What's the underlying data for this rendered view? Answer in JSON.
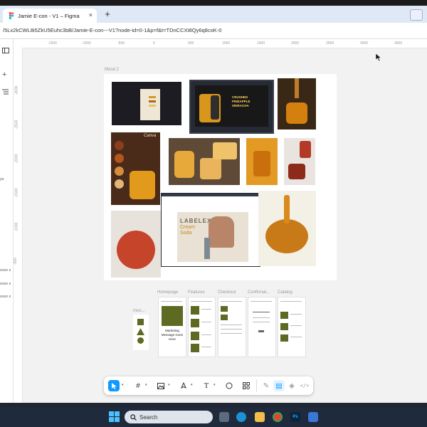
{
  "browser": {
    "tab_title": "Jamie E-con - V1 – Figma",
    "tab_close": "×",
    "new_tab": "+",
    "url": "/5Lx2kCWL8i5ZkU5Euhc3bB/Jamie-E-con---V1?node-id=0-1&p=f&t=TDnCCXt8Qy6q8coK-0"
  },
  "rulers": {
    "top_ticks": [
      "-1500",
      "-1000",
      "-500",
      "0",
      "500",
      "1000",
      "1500",
      "2000",
      "2500",
      "3000",
      "3500"
    ],
    "left_ticks": [
      "-3000",
      "-2500",
      "-2000",
      "-1500",
      "-1000",
      "-500"
    ]
  },
  "left_panel": {
    "fragments": [
      "ys",
      "xxxx x",
      "xxxx x",
      "xxxx x"
    ]
  },
  "canvas": {
    "moodboard_label": "Mood 2",
    "mood_small_label": "moo...",
    "wireframe_labels": [
      "Homepage",
      "Features",
      "Checkout",
      "Confirmat...",
      "Catalog"
    ],
    "homepage_text": "Marketing Message Goes Here",
    "soda_brand": "LABELEX",
    "soda_sub": "Cream Soda",
    "canva_text": "Canva",
    "pineapple_text": "CRUSHED PINEAPPLE SRIRACHA"
  },
  "toolbar": {
    "tools": [
      "move-tool",
      "frame-tool",
      "shape-tool",
      "pen-tool",
      "text-tool",
      "comment-tool",
      "actions-tool",
      "dev-toggle-a",
      "dev-toggle-b",
      "dev-toggle-c",
      "code-tool"
    ]
  },
  "taskbar": {
    "search_placeholder": "Search"
  },
  "colors": {
    "olive": "#5c6a22",
    "honey": "#d98a1c",
    "tab_bg": "#dfe8f5",
    "taskbar": "#1f2a3c"
  }
}
